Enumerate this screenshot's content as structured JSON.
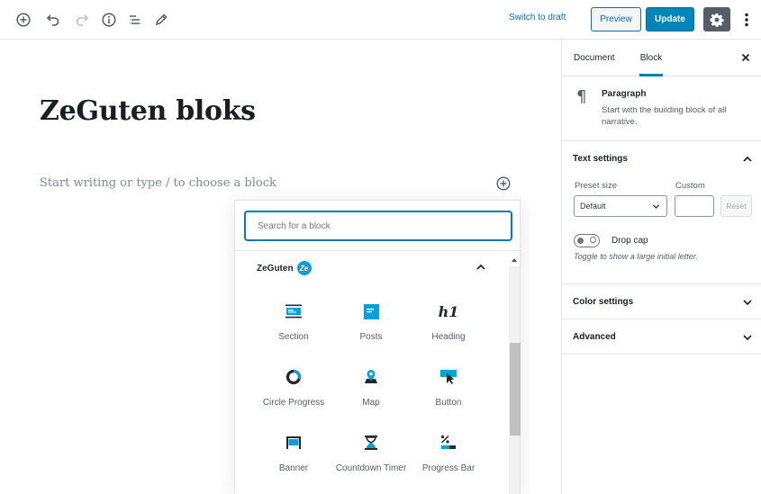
{
  "toolbar": {
    "switch_draft": "Switch to draft",
    "preview": "Preview",
    "update": "Update",
    "icons": [
      "add-block-icon",
      "undo-icon",
      "redo-icon",
      "info-icon",
      "block-navigation-icon",
      "edit-icon",
      "gear-icon",
      "more-vertical-icon"
    ]
  },
  "editor": {
    "title": "ZeGuten bloks",
    "placeholder": "Start writing or type / to choose a block"
  },
  "inserter": {
    "search_placeholder": "Search for a block",
    "category": {
      "title": "ZeGuten",
      "logo": "Ze"
    },
    "blocks": [
      {
        "label": "Section",
        "icon": "section-icon"
      },
      {
        "label": "Posts",
        "icon": "posts-icon"
      },
      {
        "label": "Heading",
        "icon": "heading-icon"
      },
      {
        "label": "Circle Progress",
        "icon": "circle-progress-icon"
      },
      {
        "label": "Map",
        "icon": "map-icon"
      },
      {
        "label": "Button",
        "icon": "button-icon"
      },
      {
        "label": "Banner",
        "icon": "banner-icon"
      },
      {
        "label": "Countdown Timer",
        "icon": "countdown-timer-icon"
      },
      {
        "label": "Progress Bar",
        "icon": "progress-bar-icon"
      }
    ],
    "heading_glyph": "h1"
  },
  "sidebar": {
    "tabs": [
      "Document",
      "Block"
    ],
    "active_tab": "Block",
    "block_card": {
      "icon": "¶",
      "title": "Paragraph",
      "description": "Start with the building block of all narrative."
    },
    "text_settings": {
      "title": "Text settings",
      "preset_label": "Preset size",
      "preset_value": "Default",
      "custom_label": "Custom",
      "reset": "Reset",
      "drop_cap": "Drop cap",
      "drop_cap_help": "Toggle to show a large initial letter."
    },
    "color_settings": "Color settings",
    "advanced": "Advanced"
  },
  "colors": {
    "accent": "#007cba",
    "update_bg": "#0085ba",
    "block_icon": "#0a9fd8",
    "dark_icon": "#23282d"
  }
}
